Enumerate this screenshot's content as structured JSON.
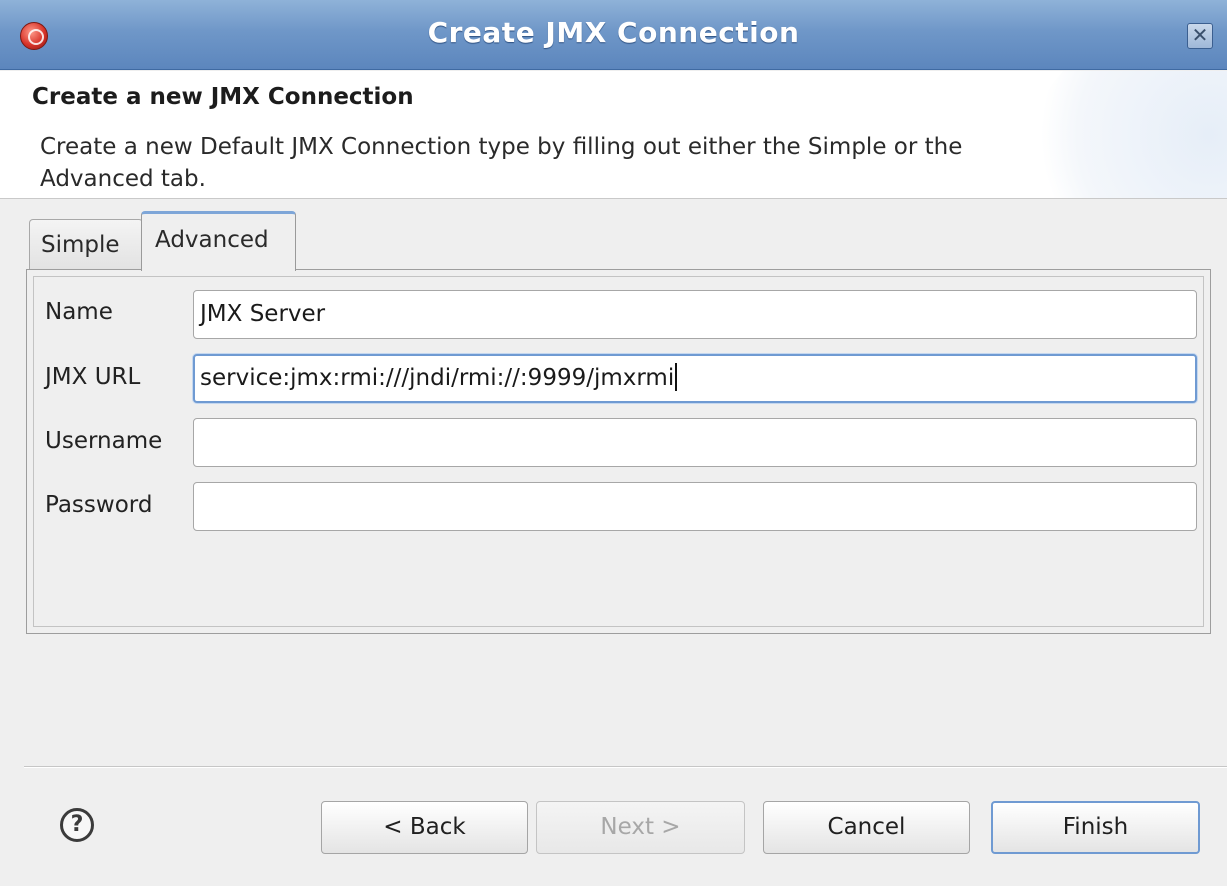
{
  "window": {
    "title": "Create JMX Connection",
    "close_glyph": "✕"
  },
  "header": {
    "heading": "Create a new JMX Connection",
    "description": "Create a new Default JMX Connection type by filling out either the Simple or the Advanced tab."
  },
  "tabs": [
    {
      "label": "Simple",
      "selected": false
    },
    {
      "label": "Advanced",
      "selected": true
    }
  ],
  "form": {
    "name": {
      "label": "Name",
      "value": "JMX Server"
    },
    "jmx_url": {
      "label": "JMX URL",
      "value": "service:jmx:rmi:///jndi/rmi://:9999/jmxrmi"
    },
    "username": {
      "label": "Username",
      "value": ""
    },
    "password": {
      "label": "Password",
      "value": ""
    }
  },
  "footer": {
    "help_glyph": "?",
    "back_label": "< Back",
    "next_label": "Next >",
    "cancel_label": "Cancel",
    "finish_label": "Finish"
  },
  "colors": {
    "titlebar": "#6f97c8",
    "focus_accent": "#6f9ad2"
  }
}
